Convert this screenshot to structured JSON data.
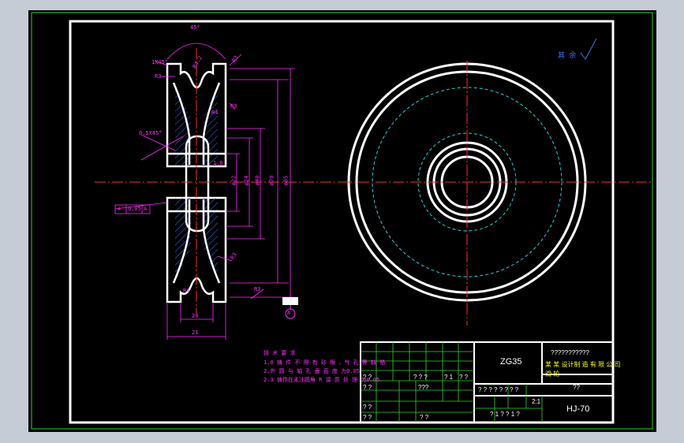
{
  "dims": {
    "angle_top": "45°",
    "chamfer_1": "1X45°",
    "r_top": "R4.2",
    "r_left": "R3",
    "r_mid_right": "R4",
    "r_right_top": "R3",
    "chamfer_2": "0.5X45°",
    "key_small": "1.6",
    "dia_1": "ø22",
    "dia_2": "ø24",
    "dia_3": "ø40",
    "dia_4": "ø70",
    "dia_5": "ø85",
    "r_low_right": "R3",
    "r_low_left": "R4",
    "r_bottom_right": "R3",
    "width_inner": "20",
    "width_outer": "21",
    "datum_label": "A",
    "tolerance_symbol": "⊥",
    "tolerance_value": "0.05",
    "tolerance_ref": "A",
    "roughness_corner": "其 余"
  },
  "notes": {
    "title": "技 术 要 求",
    "line1": "1.0 铸 件 不 得 有 砂 眼 、气 孔 等 缺 陷 ",
    "line2": "2.外 圆 与 轴 孔 垂 直 度 为0.05",
    "line3": "2.3 铸件在未注圆角 R 调 质 处 理 为0.05."
  },
  "titleblock": {
    "material": "ZG35",
    "company_top": "???????????",
    "company_main": "某 某 设计制 造 有 限 公 司",
    "drawing_name": "滑 轮",
    "drawing_no": "HJ-70",
    "scale_row": "? ? ? ?     ? ?    ? ?",
    "scale_val": "2:1",
    "weight_row": "??",
    "sheet_row": "? 1 ?   ? 1 ?",
    "r1_a": "? ?",
    "r1_b": "? ? ?",
    "r1_c": "? 1",
    "r1_d": "? ?",
    "r2_a": "? ?",
    "r2_b": "???",
    "r3_a": "? ?",
    "r4_a": "? ?",
    "r4_b": "? ?"
  }
}
